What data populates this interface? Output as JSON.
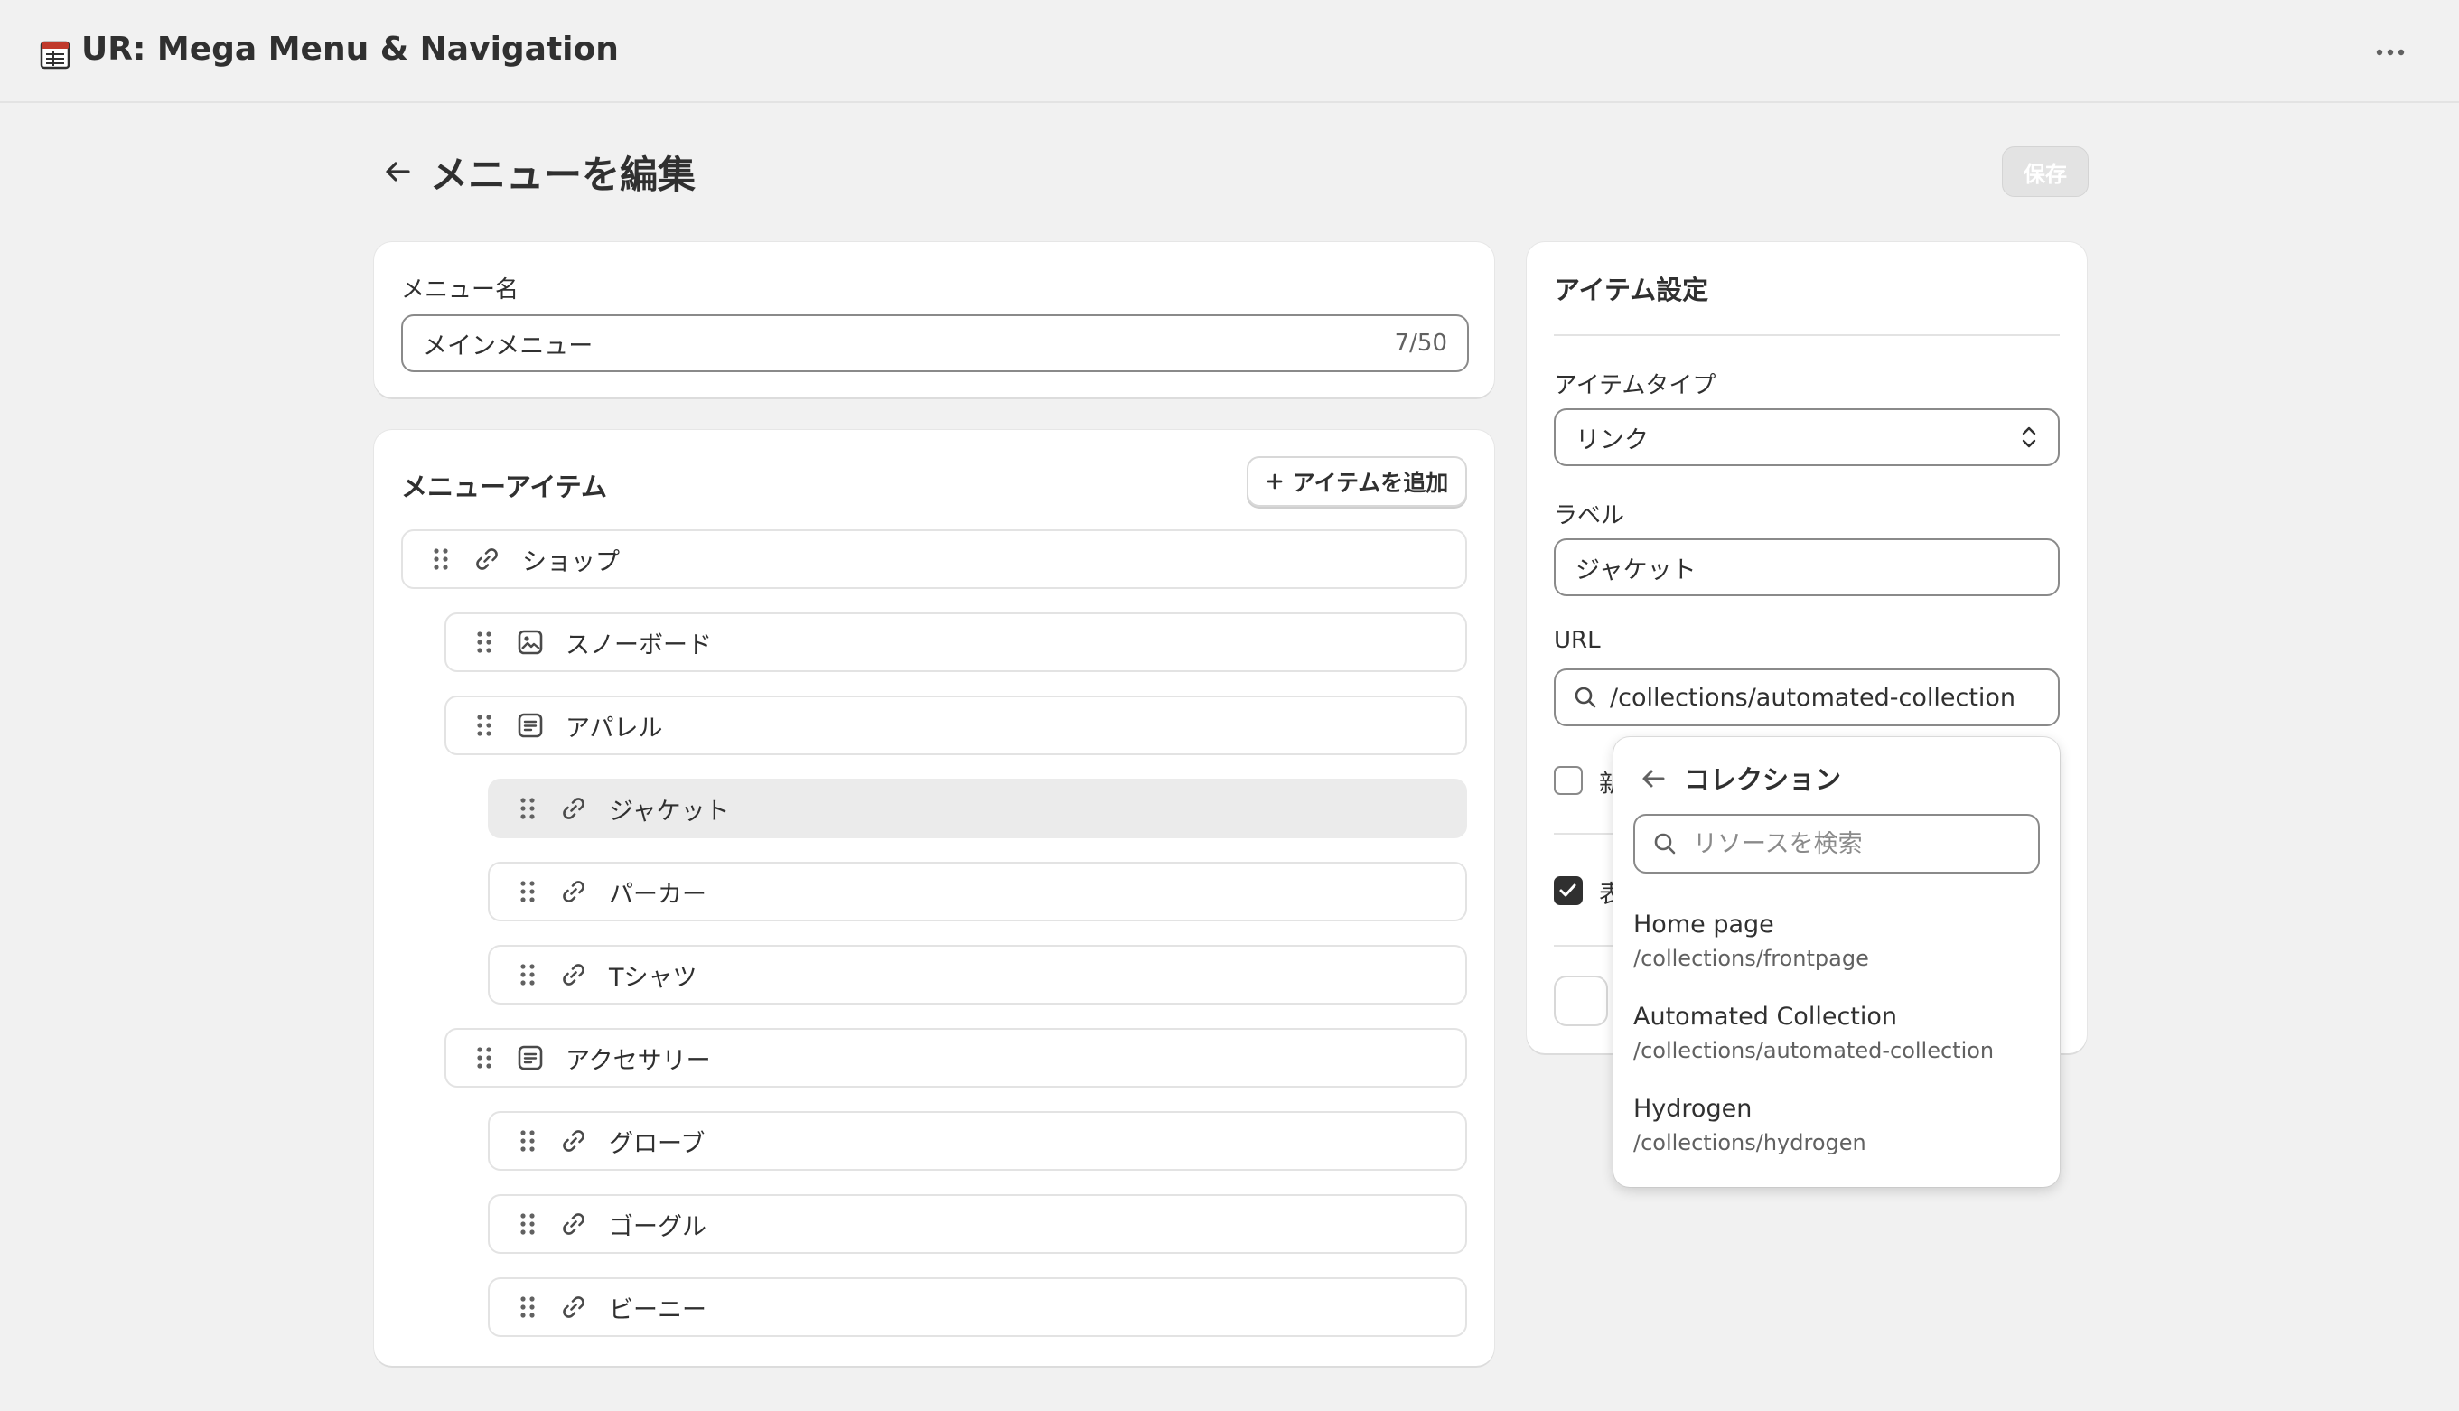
{
  "app": {
    "title": "UR: Mega Menu & Navigation"
  },
  "header": {
    "title": "メニューを編集",
    "save_label": "保存"
  },
  "menu_name": {
    "label": "メニュー名",
    "value": "メインメニュー",
    "counter": "7/50"
  },
  "menu_items": {
    "title": "メニューアイテム",
    "add_label": "アイテムを追加",
    "items": [
      {
        "label": "ショップ",
        "icon": "link-icon",
        "level": 0
      },
      {
        "label": "スノーボード",
        "icon": "collection-icon",
        "level": 1
      },
      {
        "label": "アパレル",
        "icon": "list-icon",
        "level": 1
      },
      {
        "label": "ジャケット",
        "icon": "link-icon",
        "level": 2,
        "selected": true
      },
      {
        "label": "パーカー",
        "icon": "link-icon",
        "level": 2
      },
      {
        "label": "Tシャツ",
        "icon": "link-icon",
        "level": 2
      },
      {
        "label": "アクセサリー",
        "icon": "list-icon",
        "level": 1
      },
      {
        "label": "グローブ",
        "icon": "link-icon",
        "level": 2
      },
      {
        "label": "ゴーグル",
        "icon": "link-icon",
        "level": 2
      },
      {
        "label": "ビーニー",
        "icon": "link-icon",
        "level": 2
      }
    ]
  },
  "item_settings": {
    "title": "アイテム設定",
    "type_label": "アイテムタイプ",
    "type_value": "リンク",
    "label_label": "ラベル",
    "label_value": "ジャケット",
    "url_label": "URL",
    "url_value": "/collections/automated-collection",
    "checkbox1_text": "新",
    "checkbox2_text": "表"
  },
  "popover": {
    "title": "コレクション",
    "search_placeholder": "リソースを検索",
    "items": [
      {
        "name": "Home page",
        "path": "/collections/frontpage"
      },
      {
        "name": "Automated Collection",
        "path": "/collections/automated-collection"
      },
      {
        "name": "Hydrogen",
        "path": "/collections/hydrogen"
      }
    ]
  }
}
